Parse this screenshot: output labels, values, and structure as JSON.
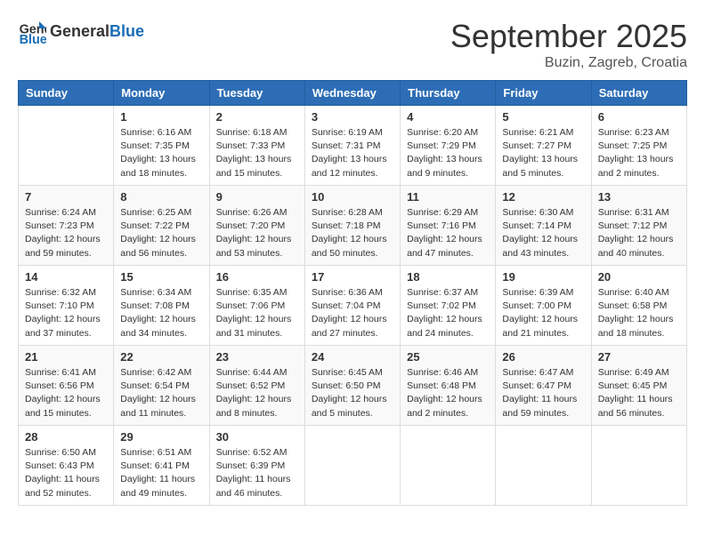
{
  "header": {
    "logo_general": "General",
    "logo_blue": "Blue",
    "month": "September 2025",
    "location": "Buzin, Zagreb, Croatia"
  },
  "weekdays": [
    "Sunday",
    "Monday",
    "Tuesday",
    "Wednesday",
    "Thursday",
    "Friday",
    "Saturday"
  ],
  "weeks": [
    [
      {
        "day": "",
        "content": ""
      },
      {
        "day": "1",
        "content": "Sunrise: 6:16 AM\nSunset: 7:35 PM\nDaylight: 13 hours\nand 18 minutes."
      },
      {
        "day": "2",
        "content": "Sunrise: 6:18 AM\nSunset: 7:33 PM\nDaylight: 13 hours\nand 15 minutes."
      },
      {
        "day": "3",
        "content": "Sunrise: 6:19 AM\nSunset: 7:31 PM\nDaylight: 13 hours\nand 12 minutes."
      },
      {
        "day": "4",
        "content": "Sunrise: 6:20 AM\nSunset: 7:29 PM\nDaylight: 13 hours\nand 9 minutes."
      },
      {
        "day": "5",
        "content": "Sunrise: 6:21 AM\nSunset: 7:27 PM\nDaylight: 13 hours\nand 5 minutes."
      },
      {
        "day": "6",
        "content": "Sunrise: 6:23 AM\nSunset: 7:25 PM\nDaylight: 13 hours\nand 2 minutes."
      }
    ],
    [
      {
        "day": "7",
        "content": "Sunrise: 6:24 AM\nSunset: 7:23 PM\nDaylight: 12 hours\nand 59 minutes."
      },
      {
        "day": "8",
        "content": "Sunrise: 6:25 AM\nSunset: 7:22 PM\nDaylight: 12 hours\nand 56 minutes."
      },
      {
        "day": "9",
        "content": "Sunrise: 6:26 AM\nSunset: 7:20 PM\nDaylight: 12 hours\nand 53 minutes."
      },
      {
        "day": "10",
        "content": "Sunrise: 6:28 AM\nSunset: 7:18 PM\nDaylight: 12 hours\nand 50 minutes."
      },
      {
        "day": "11",
        "content": "Sunrise: 6:29 AM\nSunset: 7:16 PM\nDaylight: 12 hours\nand 47 minutes."
      },
      {
        "day": "12",
        "content": "Sunrise: 6:30 AM\nSunset: 7:14 PM\nDaylight: 12 hours\nand 43 minutes."
      },
      {
        "day": "13",
        "content": "Sunrise: 6:31 AM\nSunset: 7:12 PM\nDaylight: 12 hours\nand 40 minutes."
      }
    ],
    [
      {
        "day": "14",
        "content": "Sunrise: 6:32 AM\nSunset: 7:10 PM\nDaylight: 12 hours\nand 37 minutes."
      },
      {
        "day": "15",
        "content": "Sunrise: 6:34 AM\nSunset: 7:08 PM\nDaylight: 12 hours\nand 34 minutes."
      },
      {
        "day": "16",
        "content": "Sunrise: 6:35 AM\nSunset: 7:06 PM\nDaylight: 12 hours\nand 31 minutes."
      },
      {
        "day": "17",
        "content": "Sunrise: 6:36 AM\nSunset: 7:04 PM\nDaylight: 12 hours\nand 27 minutes."
      },
      {
        "day": "18",
        "content": "Sunrise: 6:37 AM\nSunset: 7:02 PM\nDaylight: 12 hours\nand 24 minutes."
      },
      {
        "day": "19",
        "content": "Sunrise: 6:39 AM\nSunset: 7:00 PM\nDaylight: 12 hours\nand 21 minutes."
      },
      {
        "day": "20",
        "content": "Sunrise: 6:40 AM\nSunset: 6:58 PM\nDaylight: 12 hours\nand 18 minutes."
      }
    ],
    [
      {
        "day": "21",
        "content": "Sunrise: 6:41 AM\nSunset: 6:56 PM\nDaylight: 12 hours\nand 15 minutes."
      },
      {
        "day": "22",
        "content": "Sunrise: 6:42 AM\nSunset: 6:54 PM\nDaylight: 12 hours\nand 11 minutes."
      },
      {
        "day": "23",
        "content": "Sunrise: 6:44 AM\nSunset: 6:52 PM\nDaylight: 12 hours\nand 8 minutes."
      },
      {
        "day": "24",
        "content": "Sunrise: 6:45 AM\nSunset: 6:50 PM\nDaylight: 12 hours\nand 5 minutes."
      },
      {
        "day": "25",
        "content": "Sunrise: 6:46 AM\nSunset: 6:48 PM\nDaylight: 12 hours\nand 2 minutes."
      },
      {
        "day": "26",
        "content": "Sunrise: 6:47 AM\nSunset: 6:47 PM\nDaylight: 11 hours\nand 59 minutes."
      },
      {
        "day": "27",
        "content": "Sunrise: 6:49 AM\nSunset: 6:45 PM\nDaylight: 11 hours\nand 56 minutes."
      }
    ],
    [
      {
        "day": "28",
        "content": "Sunrise: 6:50 AM\nSunset: 6:43 PM\nDaylight: 11 hours\nand 52 minutes."
      },
      {
        "day": "29",
        "content": "Sunrise: 6:51 AM\nSunset: 6:41 PM\nDaylight: 11 hours\nand 49 minutes."
      },
      {
        "day": "30",
        "content": "Sunrise: 6:52 AM\nSunset: 6:39 PM\nDaylight: 11 hours\nand 46 minutes."
      },
      {
        "day": "",
        "content": ""
      },
      {
        "day": "",
        "content": ""
      },
      {
        "day": "",
        "content": ""
      },
      {
        "day": "",
        "content": ""
      }
    ]
  ]
}
